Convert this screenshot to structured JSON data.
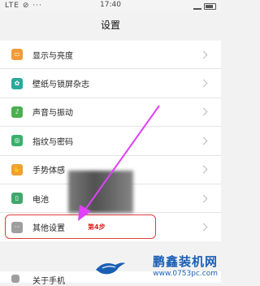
{
  "status_bar": {
    "left": "LTE ⊘ ···",
    "time": "17:40"
  },
  "header": {
    "title": "设置"
  },
  "settings": [
    {
      "label": "显示与亮度",
      "icon": "display-icon",
      "color": "#f29a38",
      "glyph": "▭"
    },
    {
      "label": "壁纸与锁屏杂志",
      "icon": "wallpaper-icon",
      "color": "#2ca89a",
      "glyph": "✿"
    },
    {
      "label": "声音与振动",
      "icon": "sound-icon",
      "color": "#4caf50",
      "glyph": "♪"
    },
    {
      "label": "指纹与密码",
      "icon": "fingerprint-icon",
      "color": "#3ab06e",
      "glyph": "◎"
    },
    {
      "label": "手势体感",
      "icon": "gesture-icon",
      "color": "#f0a030",
      "glyph": "✋"
    },
    {
      "label": "电池",
      "icon": "battery-icon",
      "color": "#3fa86b",
      "glyph": "▯"
    },
    {
      "label": "其他设置",
      "icon": "more-icon",
      "color": "#9e9e9e",
      "glyph": "···"
    }
  ],
  "annotation": {
    "step": "第4步",
    "color": "#e23c3c",
    "arrow_color": "#e040fb"
  },
  "bottom_row": {
    "label": "关于手机"
  },
  "watermark": {
    "brand": "鹏鑫装机网",
    "url": "www.0753pc.com",
    "color": "#1a5fb4"
  }
}
